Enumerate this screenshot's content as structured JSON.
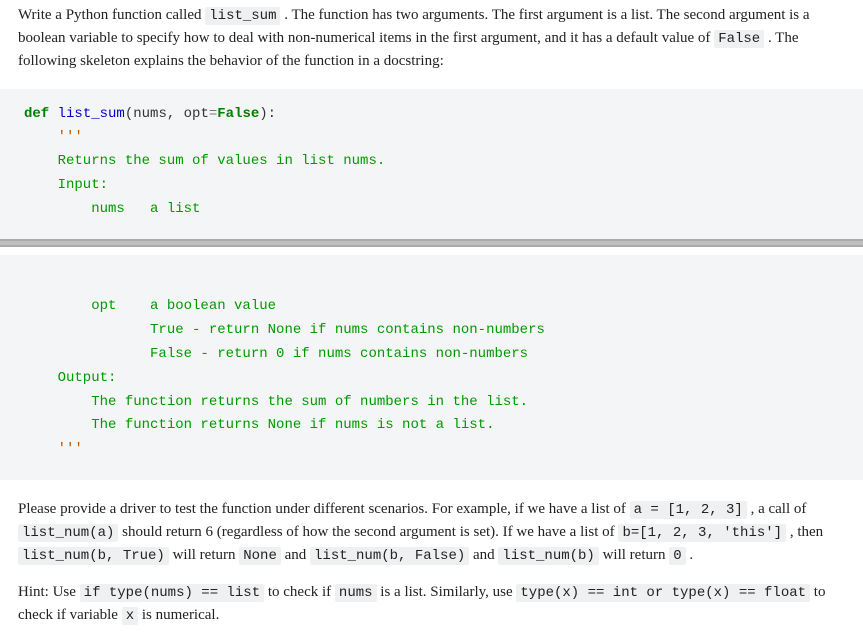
{
  "intro": {
    "t1": "Write a Python function called ",
    "c1": "list_sum",
    "t2": " . The function has two arguments. The first argument is a list. The second argument is a boolean variable to specify how to deal with non-numerical items in the first argument, and it has a default value of ",
    "c2": "False",
    "t3": " . The following skeleton explains the behavior of the function in a docstring:"
  },
  "code1": {
    "def": "def",
    "fn": "list_sum",
    "open": "(nums, opt",
    "eq": "=",
    "false": "False",
    "close": "):",
    "q": "    '''",
    "l1": "    Returns the sum of values in list nums.",
    "l2": "    Input:",
    "l3": "        nums   a list"
  },
  "code2": {
    "l1": "        opt    a boolean value",
    "l2": "               True - return None if nums contains non-numbers",
    "l3": "               False - return 0 if nums contains non-numbers",
    "l4": "    Output:",
    "l5": "        The function returns the sum of numbers in the list.",
    "l6": "        The function returns None if nums is not a list.",
    "q": "    '''"
  },
  "outro": {
    "t1": "Please provide a driver to test the function under different scenarios. For example, if we have a list of ",
    "c1": "a = [1, 2, 3]",
    "t2": " , a call of ",
    "c2": "list_num(a)",
    "t3": " should return 6 (regardless of how the second argument is set). If we have a list of ",
    "c3": "b=[1, 2, 3, 'this']",
    "t4": " , then ",
    "c4": "list_num(b, True)",
    "t5": " will return ",
    "c5": "None",
    "t6": " and ",
    "c6": "list_num(b, False)",
    "t7": " and ",
    "c7": "list_num(b)",
    "t8": " will return ",
    "c8": "0",
    "t9": " ."
  },
  "hint": {
    "t1": "Hint: Use ",
    "c1": "if type(nums) == list",
    "t2": " to check if ",
    "c2": "nums",
    "t3": " is a list. Similarly, use ",
    "c3": "type(x) == int or type(x) == float",
    "t4": " to check if variable ",
    "c4": "x",
    "t5": " is numerical."
  }
}
